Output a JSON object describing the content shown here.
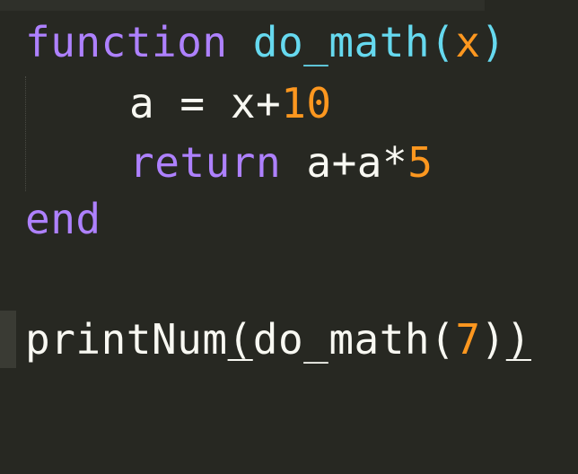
{
  "code": {
    "line1": {
      "kw_function": "function",
      "fn_name": "do_math",
      "lparen": "(",
      "param": "x",
      "rparen": ")"
    },
    "line2": {
      "var": "a",
      "eq": "=",
      "x": "x",
      "plus": "+",
      "num": "10"
    },
    "line3": {
      "kw_return": "return",
      "a1": "a",
      "plus": "+",
      "a2": "a",
      "star": "*",
      "num": "5"
    },
    "line4": {
      "kw_end": "end"
    },
    "line6": {
      "fn_printnum": "printNum",
      "lparen1": "(",
      "fn_inner": "do_math",
      "lparen2": "(",
      "num": "7",
      "rparen2": ")",
      "rparen1": ")"
    }
  },
  "colors": {
    "background": "#272822",
    "keyword": "#ae81ff",
    "function": "#66d9ef",
    "number": "#fd971f",
    "text": "#f8f8f2"
  }
}
